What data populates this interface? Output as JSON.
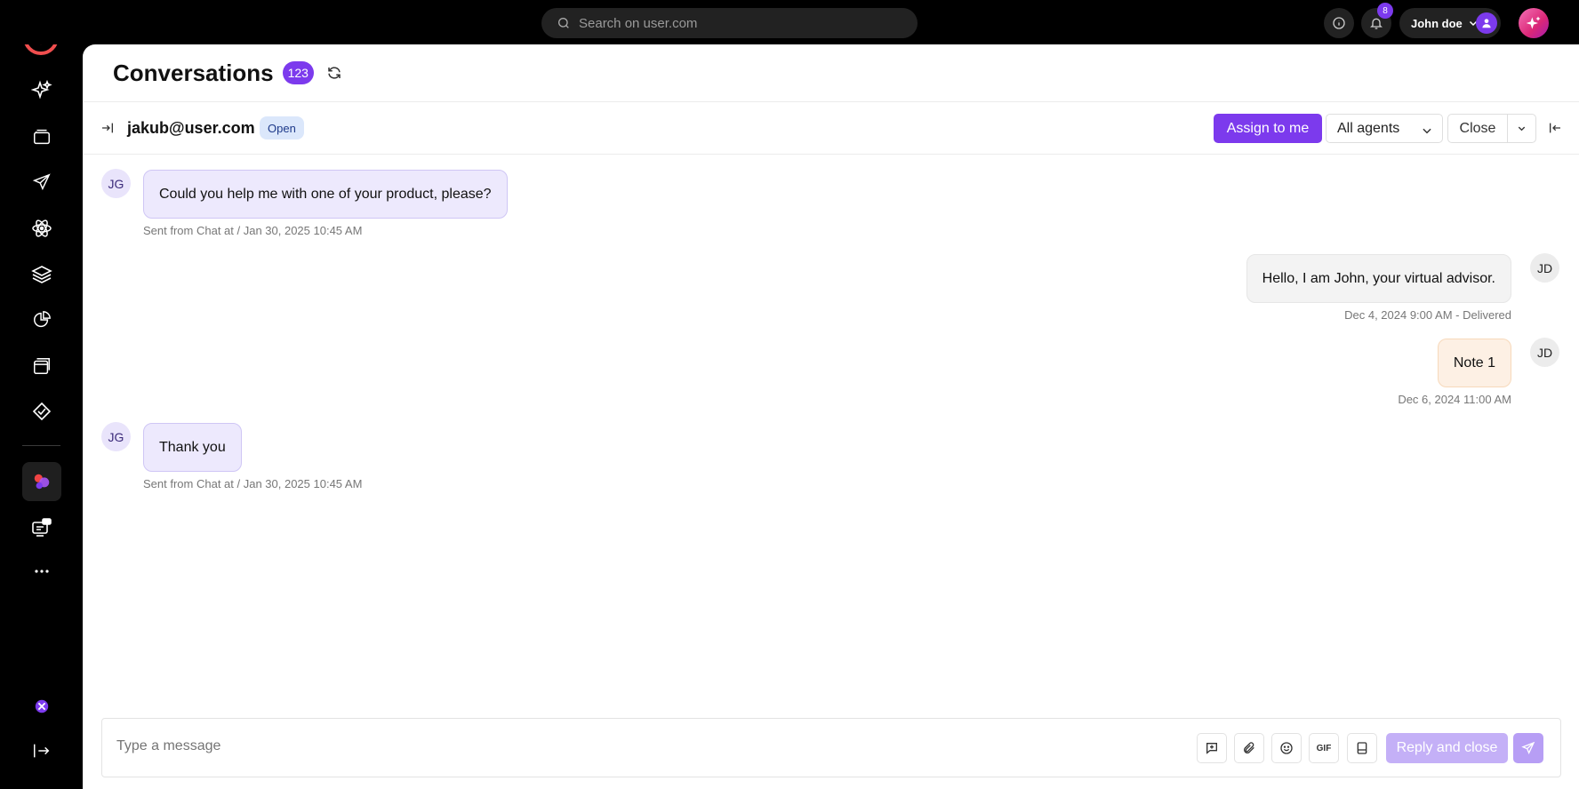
{
  "topbar": {
    "search_placeholder": "Search on user.com",
    "notification_count": "8",
    "user_name": "John doe"
  },
  "sidebar": {
    "items": [
      {
        "icon": "sparkles-icon"
      },
      {
        "icon": "folder-icon"
      },
      {
        "icon": "send-icon"
      },
      {
        "icon": "atom-icon"
      },
      {
        "icon": "layers-icon"
      },
      {
        "icon": "pie-chart-icon"
      },
      {
        "icon": "windows-icon"
      },
      {
        "icon": "tag-icon"
      },
      {
        "icon": "conversations-icon",
        "active": true
      },
      {
        "icon": "chat-screen-icon"
      },
      {
        "icon": "more-icon"
      }
    ]
  },
  "header": {
    "title": "Conversations",
    "count": "123"
  },
  "conversation": {
    "contact": "jakub@user.com",
    "status": "Open",
    "assign_label": "Assign to  me",
    "agent_select": "All agents",
    "close_label": "Close"
  },
  "messages": [
    {
      "side": "in",
      "avatar": "JG",
      "text": "Could you help me with one of your product, please?",
      "meta": "Sent from Chat at / Jan 30, 2025 10:45 AM"
    },
    {
      "side": "out",
      "avatar": "JD",
      "text": "Hello, I am John, your virtual advisor.",
      "meta": "Dec 4, 2024 9:00 AM - Delivered"
    },
    {
      "side": "note",
      "avatar": "JD",
      "text": "Note 1",
      "meta": "Dec 6, 2024 11:00 AM"
    },
    {
      "side": "in",
      "avatar": "JG",
      "text": "Thank you",
      "meta": "Sent from Chat at / Jan 30, 2025 10:45 AM"
    }
  ],
  "composer": {
    "placeholder": "Type a message",
    "gif_label": "GIF",
    "reply_close_label": "Reply and close"
  },
  "colors": {
    "accent": "#7c3aed",
    "incoming_bubble": "#ede9fd",
    "note_bubble": "#fdf0e4",
    "status_open": "#dbe7fb"
  }
}
